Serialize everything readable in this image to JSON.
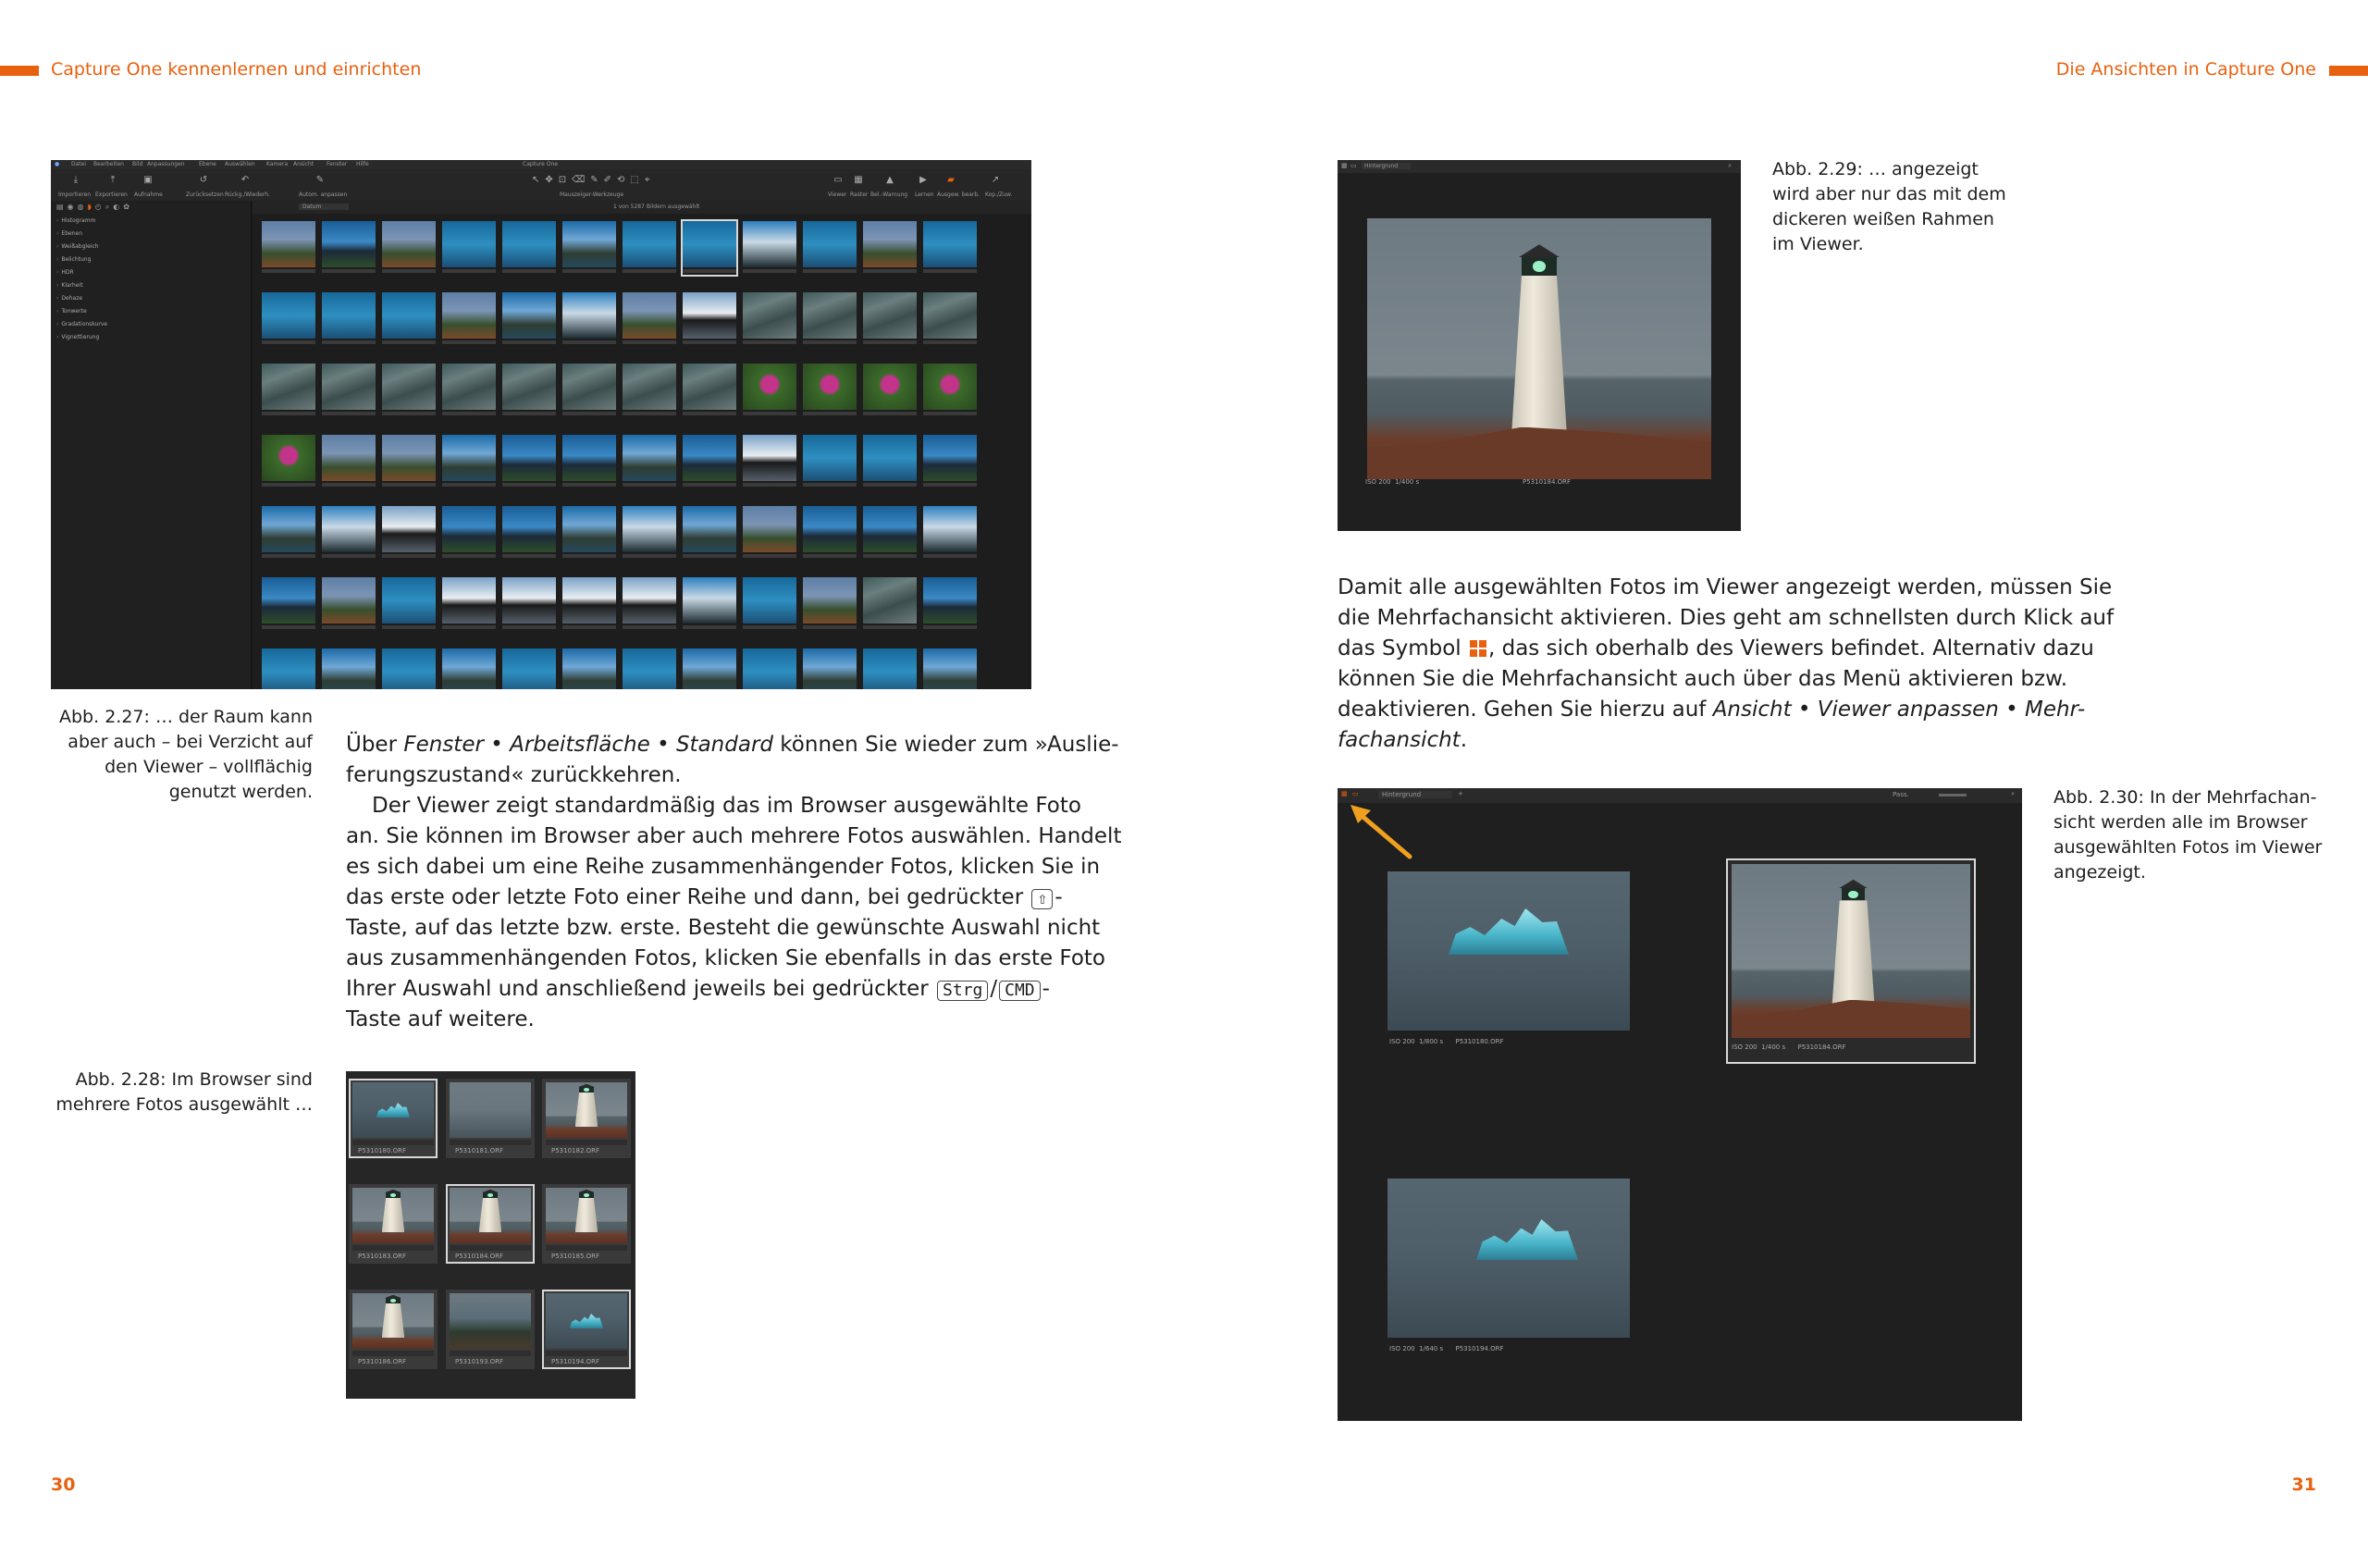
{
  "header": {
    "left_title": "Capture One kennenlernen und einrichten",
    "right_title": "Die Ansichten in Capture One"
  },
  "page_numbers": {
    "left": "30",
    "right": "31"
  },
  "colors": {
    "accent": "#e8610f",
    "text": "#1e1e1e",
    "ui_dark": "#1f1f1f"
  },
  "captions": {
    "fig227": [
      "Abb. 2.27: … der Raum kann",
      "aber auch – bei Verzicht auf",
      "den Viewer – vollflächig",
      "genutzt werden."
    ],
    "fig228": [
      "Abb. 2.28: Im Browser sind",
      "mehrere Fotos ausgewählt …"
    ],
    "fig229": [
      "Abb. 2.29: … angezeigt",
      "wird aber nur das mit dem",
      "dickeren weißen Rahmen",
      "im Viewer."
    ],
    "fig230": [
      "Abb. 2.30: In der Mehrfachan-",
      "sicht werden alle im Browser",
      "ausgewählten Fotos im Viewer",
      "angezeigt."
    ]
  },
  "left_body": {
    "l1a": "Über ",
    "l1b": "Fenster • Arbeitsfläche • Standard",
    "l1c": " können Sie wieder zum »Auslie-",
    "l2": "ferungszustand« zurückkehren.",
    "l3": "Der Viewer zeigt standardmäßig das im Browser ausgewählte Foto",
    "l4": "an. Sie können im Browser aber auch mehrere Fotos auswählen. Handelt",
    "l5": "es sich dabei um eine Reihe zusammenhängender Fotos, klicken Sie in",
    "l6a": "das erste oder letzte Foto einer Reihe und dann, bei gedrückter ",
    "key_shift": "⇧",
    "l6b": "-",
    "l7": "Taste, auf das letzte bzw. erste. Besteht die gewünschte Auswahl nicht",
    "l8": "aus zusammenhängenden Fotos, klicken Sie ebenfalls in das erste Foto",
    "l9a": "Ihrer Auswahl und anschließend jeweils bei gedrückter ",
    "key_strg": "Strg",
    "slash": "/",
    "key_cmd": "CMD",
    "l9b": "-",
    "l10": "Taste auf weitere."
  },
  "right_body": {
    "l1": "Damit alle ausgewählten Fotos im Viewer angezeigt werden, müssen Sie",
    "l2": "die Mehrfachansicht aktivieren. Dies geht am schnellsten durch Klick auf",
    "l3a": "das Symbol ",
    "l3b": ", das sich oberhalb des Viewers befindet. Alternativ dazu",
    "l4": "können Sie die Mehrfachansicht auch über das Menü aktivieren bzw.",
    "l5a": "deaktivieren. Gehen Sie hierzu auf ",
    "l5b": "Ansicht • Viewer anpassen • Mehr-",
    "l6": "fachansicht",
    "l6b": "."
  },
  "app_window": {
    "title": "Capture One",
    "menu": [
      "Datei",
      "Bearbeiten",
      "Bild",
      "Anpassungen",
      "Ebene",
      "Auswählen",
      "Kamera",
      "Ansicht",
      "Fenster",
      "Hilfe"
    ],
    "toolbar": [
      "Importieren",
      "Exportieren",
      "Aufnahme",
      "Zurücksetzen",
      "Rückg./Wiederh.",
      "Autom. anpassen",
      "Mauszeiger-Werkzeuge",
      "Viewer",
      "Raster",
      "Bel.-Warnung",
      "Lernen",
      "Ausgew. bearb.",
      "Kop./Zuw."
    ],
    "panel": [
      "Histogramm",
      "Ebenen",
      "Weißabgleich",
      "Belichtung",
      "HDR",
      "Klarheit",
      "Dehaze",
      "Tonwerte",
      "Gradationskurve",
      "Vignettierung"
    ],
    "browser_count": "1 von 5287 Bildern ausgewählt",
    "sort": "Datum"
  },
  "browser_small": {
    "filenames": [
      "P5310180.ORF",
      "P5310181.ORF",
      "P5310182.ORF",
      "P5310183.ORF",
      "P5310184.ORF",
      "P5310185.ORF",
      "P5310186.ORF",
      "P5310193.ORF",
      "P5310194.ORF"
    ]
  },
  "viewer_single": {
    "info": [
      "ISO 200",
      "1/400 s",
      "P5310184.ORF"
    ]
  },
  "viewer_multi": {
    "background_label": "Hintergrund",
    "search_label": "Pass.",
    "items": [
      {
        "iso": "ISO 200",
        "shutter": "1/800 s",
        "file": "P5310180.ORF"
      },
      {
        "iso": "ISO 200",
        "shutter": "1/400 s",
        "file": "P5310184.ORF"
      },
      {
        "iso": "ISO 200",
        "shutter": "1/640 s",
        "file": "P5310194.ORF"
      }
    ]
  }
}
